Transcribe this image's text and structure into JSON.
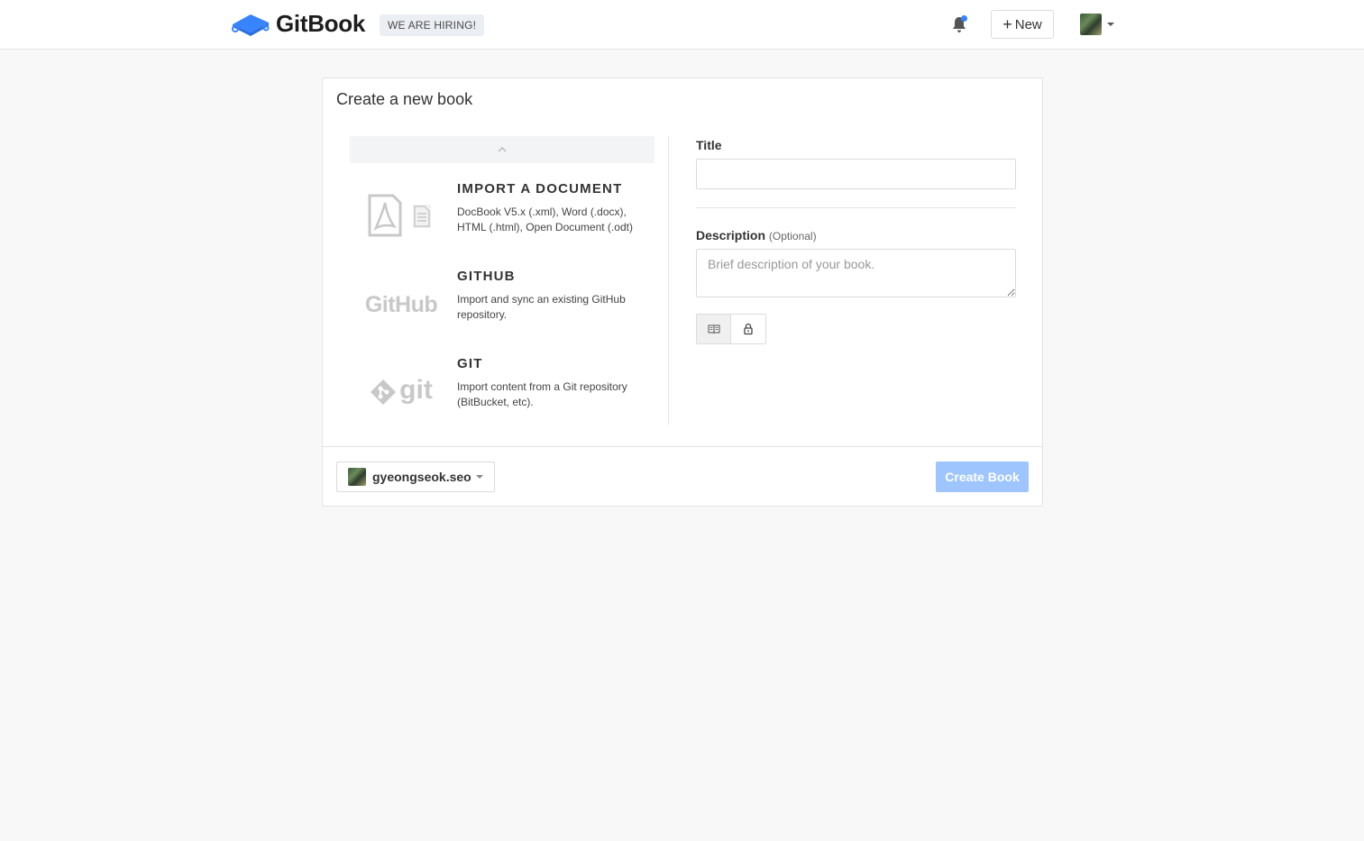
{
  "header": {
    "logo_text": "GitBook",
    "hiring_badge": "WE ARE HIRING!",
    "new_button_plus": "+",
    "new_button_label": "New",
    "accent_color": "#3884ff"
  },
  "card": {
    "title": "Create a new book",
    "options": [
      {
        "icon": "pdf-document-icon",
        "title": "IMPORT A DOCUMENT",
        "description": "DocBook V5.x (.xml), Word (.docx), HTML (.html), Open Document (.odt)"
      },
      {
        "icon": "github-logo-icon",
        "icon_text": "GitHub",
        "title": "GITHUB",
        "description": "Import and sync an existing GitHub repository."
      },
      {
        "icon": "git-logo-icon",
        "icon_text": "git",
        "title": "GIT",
        "description": "Import content from a Git repository (BitBucket, etc)."
      }
    ],
    "form": {
      "title_label": "Title",
      "title_value": "",
      "description_label": "Description",
      "description_optional": "(Optional)",
      "description_placeholder": "Brief description of your book.",
      "visibility_options": [
        "public-book-icon",
        "private-lock-icon"
      ]
    },
    "footer": {
      "owner_name": "gyeongseok.seo",
      "create_button_label": "Create Book",
      "create_button_color": "#9ec5fe"
    }
  }
}
